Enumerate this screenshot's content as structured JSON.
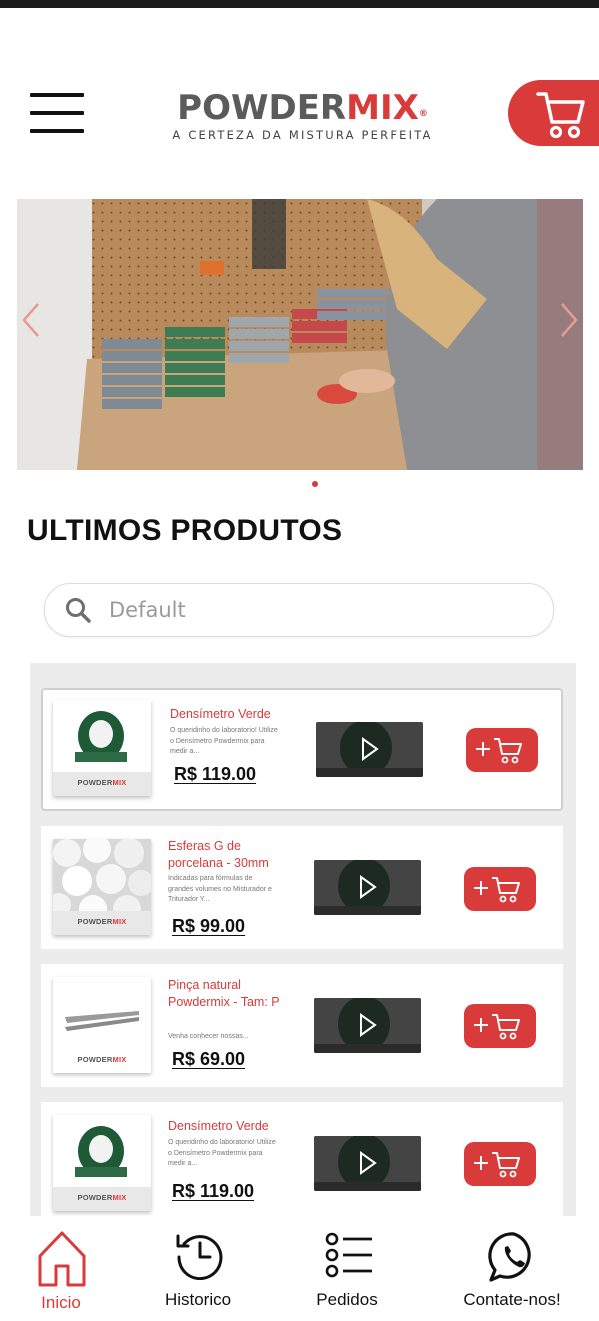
{
  "header": {
    "logo_powder": "POWDER",
    "logo_mix": "MIX",
    "logo_reg": "®",
    "logo_tagline": "A CERTEZA DA MISTURA PERFEITA",
    "menu_icon": "hamburger-icon",
    "cart_icon": "cart-icon"
  },
  "carousel": {
    "slide_count": 1,
    "active_index": 0
  },
  "section": {
    "title": "ULTIMOS PRODUTOS"
  },
  "search": {
    "placeholder": "Default",
    "value": ""
  },
  "products": [
    {
      "name": "Densímetro Verde",
      "description": "O queridinho do laboratorio! Utilize o Densímetro Powdermix para medir a...",
      "price": "R$ 119.00",
      "thumb_brand": "POWDERMIX",
      "selected": true
    },
    {
      "name": "Esferas G de porcelana - 30mm",
      "description": "Indicadas para fórmulas de grandes volumes no Misturador e Triturador Y...",
      "price": "R$ 99.00",
      "thumb_brand": "POWDERMIX",
      "selected": false
    },
    {
      "name": "Pinça natural Powdermix - Tam: P",
      "description": "Venha conhecer nossas...",
      "price": "R$ 69.00",
      "thumb_brand": "POWDERMIX",
      "selected": false
    },
    {
      "name": "Densímetro Verde",
      "description": "O queridinho do laboratorio! Utilize o Densímetro Powdermix para medir a...",
      "price": "R$ 119.00",
      "thumb_brand": "POWDERMIX",
      "selected": false
    }
  ],
  "nav": {
    "items": [
      {
        "label": "Inicio",
        "icon": "home-icon",
        "active": true
      },
      {
        "label": "Historico",
        "icon": "history-icon",
        "active": false
      },
      {
        "label": "Pedidos",
        "icon": "list-icon",
        "active": false
      },
      {
        "label": "Contate-nos!",
        "icon": "whatsapp-icon",
        "active": false
      }
    ]
  },
  "colors": {
    "accent": "#d93a3a",
    "text": "#111111",
    "list_bg": "#ececec"
  }
}
